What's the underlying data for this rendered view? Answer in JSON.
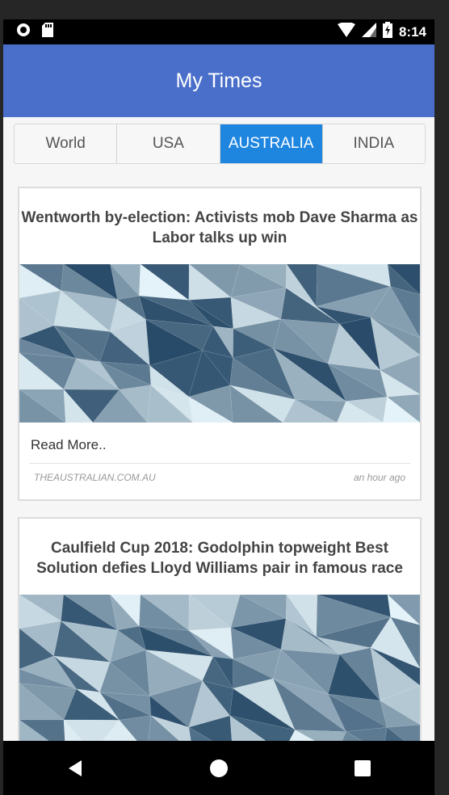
{
  "status_bar": {
    "time": "8:14",
    "icons": [
      "record-icon",
      "sd-card-icon",
      "wifi-icon",
      "signal-icon",
      "battery-charging-icon"
    ]
  },
  "app_bar": {
    "title": "My Times"
  },
  "tabs": [
    {
      "label": "World",
      "active": false
    },
    {
      "label": "USA",
      "active": false
    },
    {
      "label": "AUSTRALIA",
      "active": true
    },
    {
      "label": "INDIA",
      "active": false
    }
  ],
  "articles": [
    {
      "title": "Wentworth by-election: Activists mob Dave Sharma as Labor talks up win",
      "read_more": "Read More..",
      "source": "THEAUSTRALIAN.COM.AU",
      "time": "an hour ago"
    },
    {
      "title": "Caulfield Cup 2018: Godolphin topweight Best Solution defies Lloyd Williams pair in famous race"
    }
  ],
  "nav_bar": {
    "icons": [
      "back-icon",
      "home-icon",
      "recents-icon"
    ]
  },
  "colors": {
    "app_bar": "#4a6fcb",
    "active_tab": "#1f86e0"
  }
}
